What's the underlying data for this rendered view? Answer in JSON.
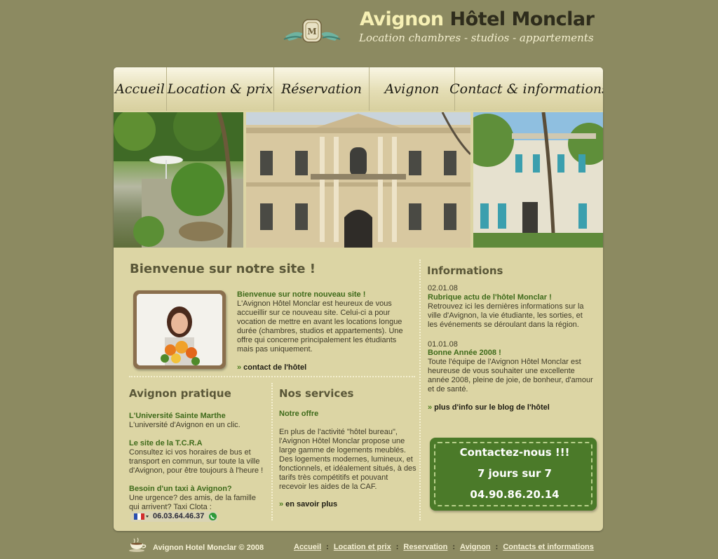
{
  "header": {
    "title_part1": "Avignon",
    "title_part2": "Hôtel Monclar",
    "tagline": "Location chambres - studios - appartements"
  },
  "nav": {
    "items": [
      {
        "label": "Accueil"
      },
      {
        "label": "Location & prix"
      },
      {
        "label": "Réservation"
      },
      {
        "label": "Avignon"
      },
      {
        "label": "Contact & informations"
      }
    ]
  },
  "welcome": {
    "title": "Bienvenue sur notre site !",
    "heading": "Bienvenue sur notre nouveau site !",
    "text": "L'Avignon Hôtel Monclar est heureux de vous accueillir sur ce nouveau site. Celui-ci a pour vocation de mettre en avant les locations longue durée (chambres, studios et appartements). Une offre qui concerne principalement les étudiants mais pas uniquement.",
    "link": "contact de l'hôtel"
  },
  "informations": {
    "title": "Informations",
    "news": [
      {
        "date": "02.01.08",
        "heading": "Rubrique actu de l'hôtel Monclar !",
        "text": "Retrouvez ici les dernières informations sur la ville d'Avignon, la vie étudiante, les sorties, et les événements se déroulant dans la région."
      },
      {
        "date": "01.01.08",
        "heading": "Bonne Année 2008 !",
        "text": "Toute l'équipe de l'Avignon Hôtel Monclar est heureuse de vous souhaiter une excellente année 2008, pleine de joie, de bonheur, d'amour et de santé."
      }
    ],
    "link": "plus d'info sur le blog de l'hôtel"
  },
  "pratique": {
    "title": "Avignon pratique",
    "items": [
      {
        "heading": "L'Université Sainte Marthe",
        "text": "L'université d'Avignon en un clic."
      },
      {
        "heading": "Le site de la T.C.R.A",
        "text": "Consultez ici vos horaires de bus et transport en commun, sur toute la ville d'Avignon, pour être toujours à l'heure !"
      },
      {
        "heading": "Besoin d'un taxi à Avignon?",
        "text": "Une urgence? des amis, de la famille qui arrivent? Taxi Clota :"
      }
    ],
    "phone": "06.03.64.46.37"
  },
  "services": {
    "title": "Nos services",
    "heading": "Notre offre",
    "text": "En plus de l'activité \"hôtel bureau\", l'Avignon Hôtel Monclar propose une large gamme de logements meublés. Des logements modernes, lumineux, et fonctionnels, et idéalement situés, à des tarifs très compétitifs et pouvant recevoir les aides de la CAF.",
    "link": "en savoir plus"
  },
  "contact_box": {
    "line1": "Contactez-nous !!!",
    "line2": "7 jours sur 7",
    "line3": "04.90.86.20.14"
  },
  "footer": {
    "copyright": "Avignon Hotel Monclar © 2008",
    "links": [
      "Accueil",
      "Location et prix",
      "Reservation",
      "Avignon",
      "Contacts et informations"
    ],
    "separator": ":"
  },
  "colors": {
    "background": "#8c8a61",
    "panel": "#dcd5a4",
    "accent_green": "#4b7a29",
    "heading_green": "#3e6a1a"
  }
}
